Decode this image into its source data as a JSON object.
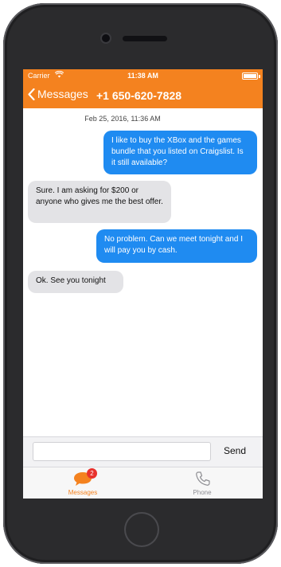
{
  "status_bar": {
    "carrier": "Carrier",
    "time": "11:38 AM"
  },
  "nav": {
    "back_label": "Messages",
    "title": "+1 650-620-7828"
  },
  "conversation": {
    "date": "Feb 25, 2016, 11:36 AM",
    "messages": [
      {
        "direction": "outgoing",
        "text": "I like to buy the XBox and the games bundle that you listed on Craigslist. Is it still available?"
      },
      {
        "direction": "incoming",
        "text": "Sure. I am asking for $200 or anyone who gives me the best offer."
      },
      {
        "direction": "outgoing",
        "text": "No problem. Can we meet tonight and I will pay you by cash."
      },
      {
        "direction": "incoming",
        "text": "Ok. See you tonight"
      }
    ]
  },
  "composer": {
    "value": "",
    "send_label": "Send"
  },
  "tabs": [
    {
      "label": "Messages",
      "icon": "chat-bubble-icon",
      "badge": "2",
      "selected": true
    },
    {
      "label": "Phone",
      "icon": "phone-icon",
      "selected": false
    }
  ],
  "colors": {
    "accent": "#f4821f",
    "outgoing_bubble": "#1f8bf1",
    "incoming_bubble": "#e3e3e6",
    "badge": "#e8322d"
  }
}
